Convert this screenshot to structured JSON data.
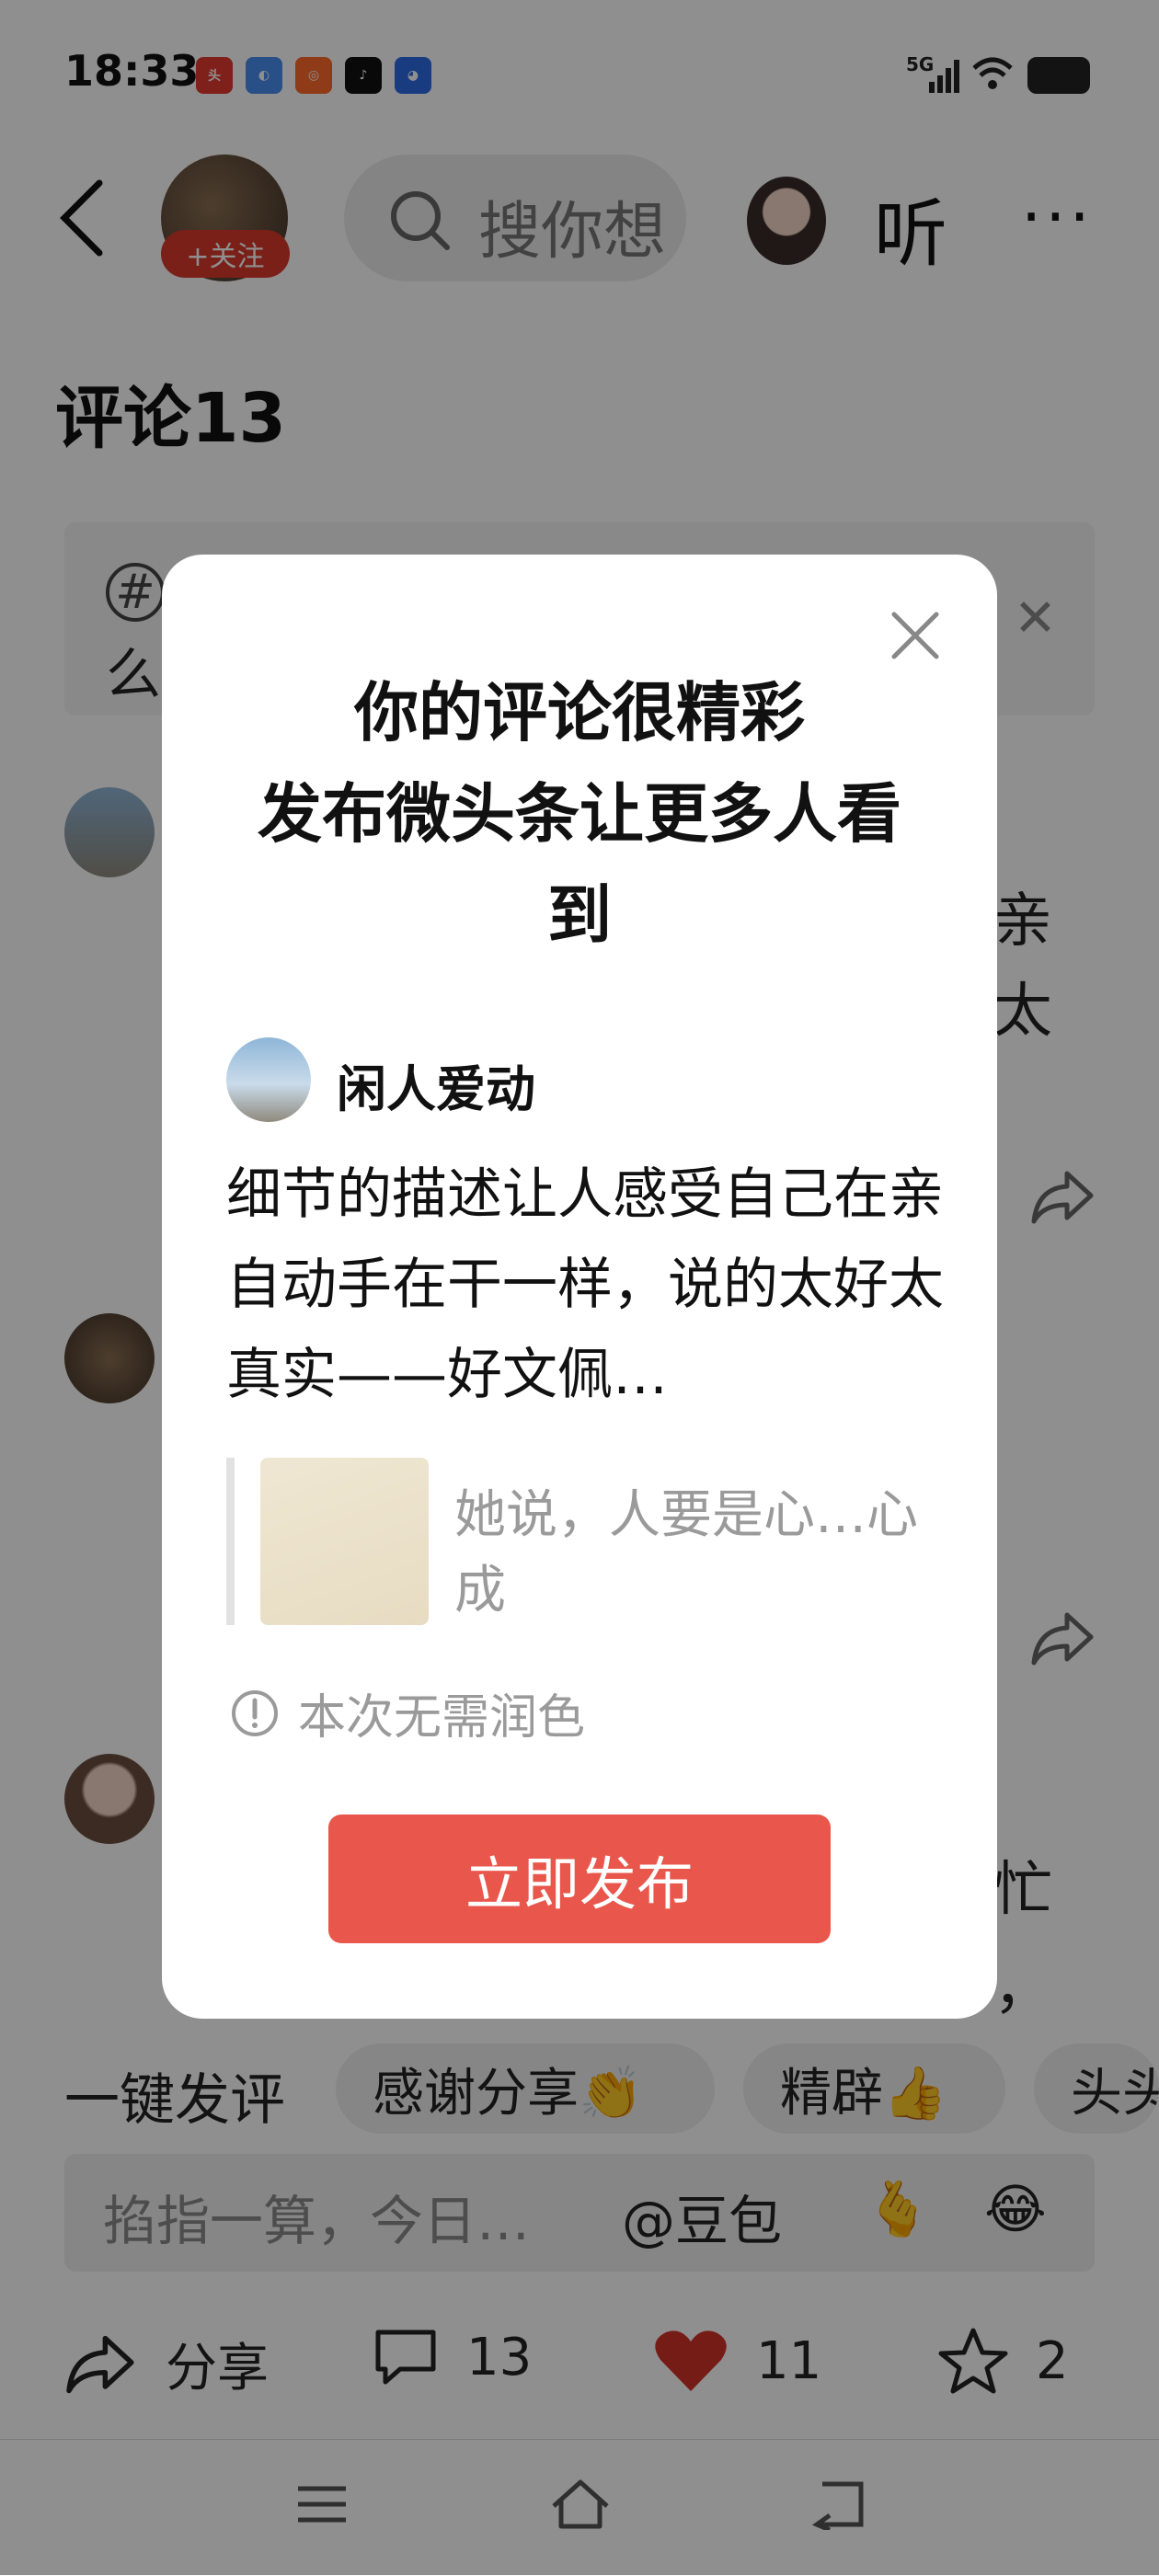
{
  "status_bar": {
    "time": "18:33",
    "network": "5G"
  },
  "header": {
    "follow_label": "+关注",
    "search_placeholder": "搜你想",
    "listen_label": "听",
    "more_label": "···"
  },
  "comments": {
    "title": "评论13",
    "topic_hint": "么",
    "partial_texts": [
      "亲",
      "太",
      "忙",
      "，"
    ]
  },
  "quick_reply": {
    "label": "一键发评",
    "chips": [
      "感谢分享👏",
      "精辟👍",
      "头头"
    ]
  },
  "input": {
    "placeholder": "掐指一算，今日…",
    "at_label": "@豆包",
    "emoji_1": "🫰",
    "emoji_2": "😂"
  },
  "toolbar": {
    "share_label": "分享",
    "comment_count": "13",
    "like_count": "11",
    "favorite_count": "2"
  },
  "modal": {
    "title_line_1": "你的评论很精彩",
    "title_line_2": "发布微头条让更多人看",
    "title_line_3": "到",
    "user_name": "闲人爱动",
    "comment_text": "细节的描述让人感受自己在亲自动手在干一样，说的太好太真实——好文佩…",
    "quote_text": "她说，人要是心…心成",
    "notice_text": "本次无需润色",
    "publish_label": "立即发布"
  },
  "colors": {
    "accent": "#e9574c",
    "follow": "#d93a2e",
    "like": "#d0322a"
  }
}
